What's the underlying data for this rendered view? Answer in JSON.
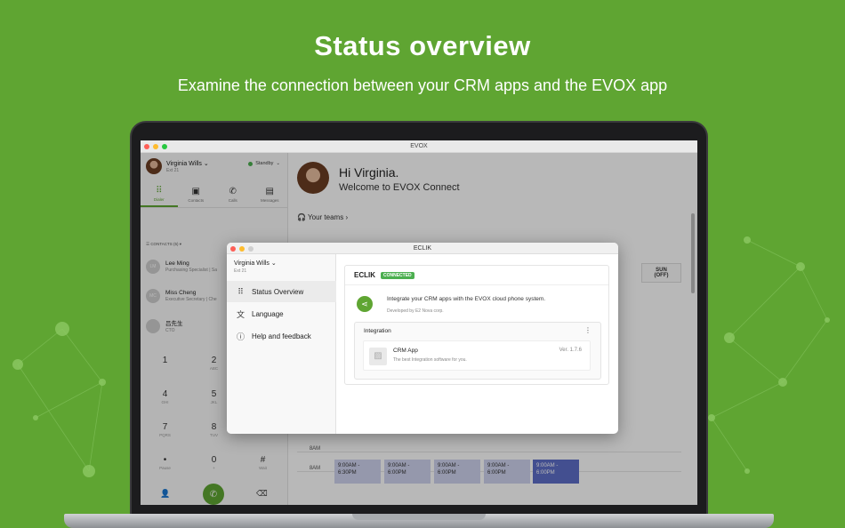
{
  "hero": {
    "title": "Status overview",
    "subtitle": "Examine the connection between your CRM apps and the EVOX app"
  },
  "colors": {
    "brand": "#5fa532",
    "connected": "#4caf50",
    "slot": "#cfd3ef",
    "slot_active": "#5e6ec8"
  },
  "main_window": {
    "title": "EVOX",
    "user": {
      "name": "Virginia Wills",
      "ext": "Ext 21",
      "status": "Standby"
    },
    "tabs": [
      {
        "label": "Dialer",
        "icon": "dialpad-icon"
      },
      {
        "label": "Contacts",
        "icon": "contacts-icon"
      },
      {
        "label": "Calls",
        "icon": "phone-icon"
      },
      {
        "label": "Messages",
        "icon": "message-icon"
      }
    ],
    "contacts_header": "CONTACTS (5)",
    "contacts": [
      {
        "initials": "LM",
        "name": "Lee Ming",
        "title": "Purchasing Specialist | Sa"
      },
      {
        "initials": "MC",
        "name": "Miss Cheng",
        "title": "Executive Secretary | Che"
      },
      {
        "initials": "",
        "name": "吕先生",
        "title": "CTO"
      }
    ],
    "keypad": [
      {
        "digit": "1",
        "letters": ""
      },
      {
        "digit": "2",
        "letters": "ABC"
      },
      {
        "digit": "4",
        "letters": "GHI"
      },
      {
        "digit": "5",
        "letters": "JKL"
      },
      {
        "digit": "7",
        "letters": "PQRS"
      },
      {
        "digit": "8",
        "letters": "TUV"
      },
      {
        "digit": "•",
        "letters": "Pause"
      },
      {
        "digit": "0",
        "letters": "+"
      },
      {
        "digit": "#",
        "letters": "Wait"
      }
    ],
    "greeting": "Hi Virginia.",
    "welcome": "Welcome to EVOX Connect",
    "teams_link": "Your teams",
    "schedule": {
      "sun_header": "SUN",
      "sun_sub": "(OFF)",
      "row_labels": [
        "8AM",
        "8AM"
      ],
      "slots": [
        "9:00AM - 6:30PM",
        "9:00AM - 6:00PM",
        "9:00AM - 6:00PM",
        "9:00AM - 6:00PM",
        "9:00AM - 6:00PM"
      ]
    }
  },
  "dialog": {
    "title": "ECLIK",
    "user": {
      "name": "Virginia Wills",
      "ext": "Ext 21"
    },
    "menu": [
      {
        "label": "Status Overview",
        "icon": "grid-icon",
        "active": true
      },
      {
        "label": "Language",
        "icon": "translate-icon",
        "active": false
      },
      {
        "label": "Help and feedback",
        "icon": "info-icon",
        "active": false
      }
    ],
    "brand": "ECLIK",
    "badge": "CONNECTED",
    "intro": "Integrate your CRM apps with the EVOX cloud phone system.",
    "developer": "Developed by E2 Nova corp.",
    "integration_label": "Integration",
    "app": {
      "name": "CRM App",
      "tagline": "The best Integration software for you.",
      "version": "Ver. 1.7.6"
    }
  }
}
